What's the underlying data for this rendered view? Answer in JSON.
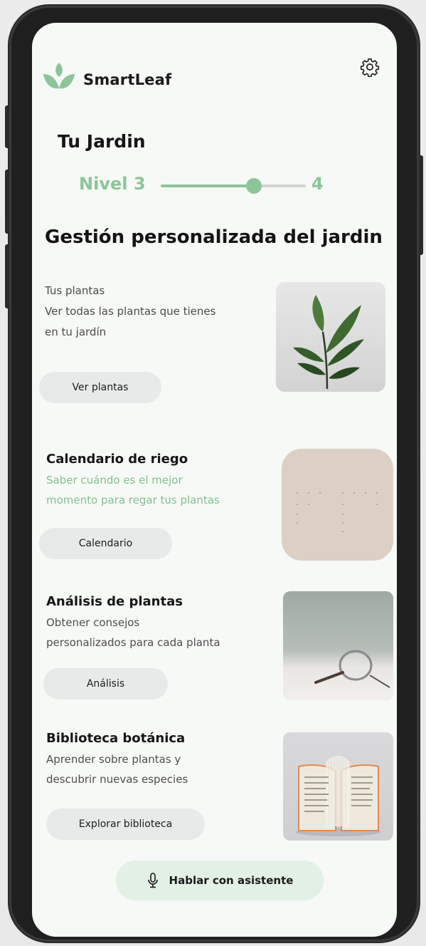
{
  "app": {
    "name": "SmartLeaf"
  },
  "colors": {
    "accent": "#8dc59b",
    "screen_bg": "#f6f9f5",
    "pill_bg": "#e7eae8"
  },
  "icons": {
    "logo": "leaf-logo-icon",
    "settings": "gear-icon",
    "assistant": "microphone-icon"
  },
  "garden": {
    "title": "Tu Jardin",
    "level_label": "Nivel 3",
    "next_level": "4",
    "progress_fraction": 0.64
  },
  "section": {
    "title": "Gestión personalizada del jardin"
  },
  "cards": [
    {
      "line1": "Tus plantas",
      "line2": "Ver todas las plantas que tienes",
      "line3": "en tu jardín",
      "button": "Ver plantas"
    },
    {
      "title": "Calendario de riego",
      "desc1": "Saber cuándo es el mejor",
      "desc2": "momento para regar tus plantas",
      "button": "Calendario"
    },
    {
      "title": "Análisis de plantas",
      "desc1": "Obtener consejos",
      "desc2": "personalizados para cada planta",
      "button": "Análisis"
    },
    {
      "title": "Biblioteca botánica",
      "desc1": "Aprender sobre plantas y",
      "desc2": "descubrir nuevas especies",
      "button": "Explorar biblioteca"
    }
  ],
  "assistant": {
    "label": "Hablar con asistente"
  }
}
